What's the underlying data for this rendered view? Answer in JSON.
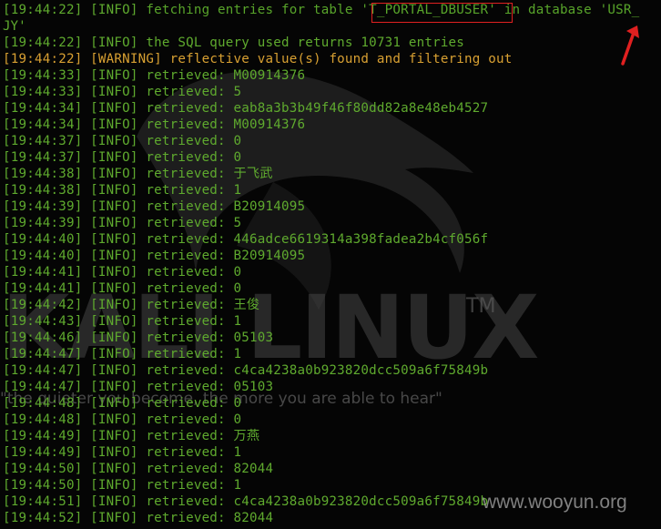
{
  "terminal": {
    "first_line_tail": "JY'",
    "lines": [
      {
        "time": "19:44:22",
        "level": "INFO",
        "message": "fetching entries for table 'T_PORTAL_DBUSER' in database 'USR_"
      },
      {
        "time": "19:44:22",
        "level": "INFO",
        "message": "the SQL query used returns 10731 entries"
      },
      {
        "time": "19:44:22",
        "level": "WARNING",
        "message": "reflective value(s) found and filtering out"
      },
      {
        "time": "19:44:33",
        "level": "INFO",
        "message": "retrieved: M00914376"
      },
      {
        "time": "19:44:33",
        "level": "INFO",
        "message": "retrieved: 5"
      },
      {
        "time": "19:44:34",
        "level": "INFO",
        "message": "retrieved: eab8a3b3b49f46f80dd82a8e48eb4527"
      },
      {
        "time": "19:44:34",
        "level": "INFO",
        "message": "retrieved: M00914376"
      },
      {
        "time": "19:44:37",
        "level": "INFO",
        "message": "retrieved: 0"
      },
      {
        "time": "19:44:37",
        "level": "INFO",
        "message": "retrieved: 0"
      },
      {
        "time": "19:44:38",
        "level": "INFO",
        "message": "retrieved: 于飞武"
      },
      {
        "time": "19:44:38",
        "level": "INFO",
        "message": "retrieved: 1"
      },
      {
        "time": "19:44:39",
        "level": "INFO",
        "message": "retrieved: B20914095"
      },
      {
        "time": "19:44:39",
        "level": "INFO",
        "message": "retrieved: 5"
      },
      {
        "time": "19:44:40",
        "level": "INFO",
        "message": "retrieved: 446adce6619314a398fadea2b4cf056f"
      },
      {
        "time": "19:44:40",
        "level": "INFO",
        "message": "retrieved: B20914095"
      },
      {
        "time": "19:44:41",
        "level": "INFO",
        "message": "retrieved: 0"
      },
      {
        "time": "19:44:41",
        "level": "INFO",
        "message": "retrieved: 0"
      },
      {
        "time": "19:44:42",
        "level": "INFO",
        "message": "retrieved: 王俊"
      },
      {
        "time": "19:44:43",
        "level": "INFO",
        "message": "retrieved: 1"
      },
      {
        "time": "19:44:46",
        "level": "INFO",
        "message": "retrieved: 05103"
      },
      {
        "time": "19:44:47",
        "level": "INFO",
        "message": "retrieved: 1"
      },
      {
        "time": "19:44:47",
        "level": "INFO",
        "message": "retrieved: c4ca4238a0b923820dcc509a6f75849b"
      },
      {
        "time": "19:44:47",
        "level": "INFO",
        "message": "retrieved: 05103"
      },
      {
        "time": "19:44:48",
        "level": "INFO",
        "message": "retrieved: 0"
      },
      {
        "time": "19:44:48",
        "level": "INFO",
        "message": "retrieved: 0"
      },
      {
        "time": "19:44:49",
        "level": "INFO",
        "message": "retrieved: 万燕"
      },
      {
        "time": "19:44:49",
        "level": "INFO",
        "message": "retrieved: 1"
      },
      {
        "time": "19:44:50",
        "level": "INFO",
        "message": "retrieved: 82044"
      },
      {
        "time": "19:44:50",
        "level": "INFO",
        "message": "retrieved: 1"
      },
      {
        "time": "19:44:51",
        "level": "INFO",
        "message": "retrieved: c4ca4238a0b923820dcc509a6f75849b"
      },
      {
        "time": "19:44:52",
        "level": "INFO",
        "message": "retrieved: 82044"
      }
    ]
  },
  "background": {
    "banner": "KALI LINUX",
    "trademark": "TM",
    "quote": "\"the quieter you become, the more you are able to hear\""
  },
  "watermark": "www.wooyun.org",
  "colors": {
    "background": "#050505",
    "info_text": "#5faa2e",
    "warning_text": "#d8a032",
    "annotation": "#e02020"
  },
  "icons": {
    "annotation_arrow": "red-arrow-icon",
    "background_logo": "kali-dragon-icon"
  }
}
